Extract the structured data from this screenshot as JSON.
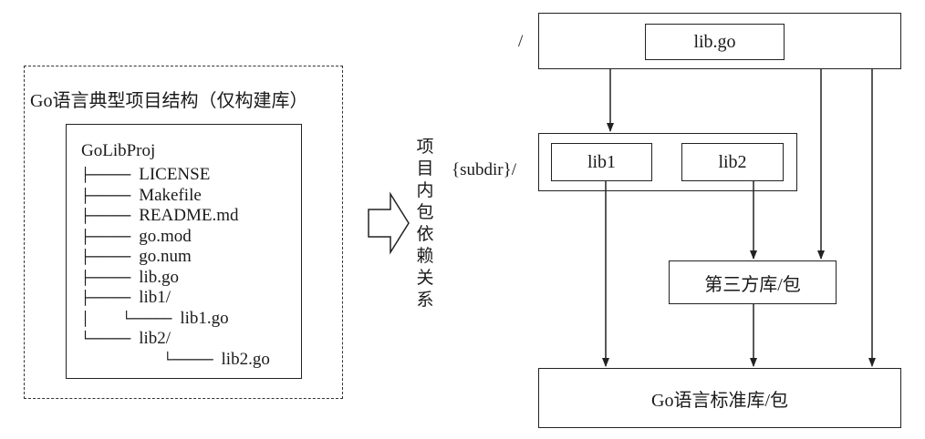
{
  "left_panel": {
    "title": "Go语言典型项目结构（仅构建库）",
    "root": "GoLibProj",
    "tree": [
      {
        "prefix": "├───── ",
        "name": "LICENSE"
      },
      {
        "prefix": "├───── ",
        "name": "Makefile"
      },
      {
        "prefix": "├───── ",
        "name": "README.md"
      },
      {
        "prefix": "├───── ",
        "name": "go.mod"
      },
      {
        "prefix": "├───── ",
        "name": "go.num"
      },
      {
        "prefix": "├───── ",
        "name": "lib.go"
      },
      {
        "prefix": "├───── ",
        "name": "lib1/"
      },
      {
        "prefix": "│    └───── ",
        "name": "lib1.go"
      },
      {
        "prefix": "└───── ",
        "name": "lib2/"
      },
      {
        "prefix": "          └───── ",
        "name": "lib2.go"
      }
    ]
  },
  "arrow_label": "项目内包依赖关系",
  "right_panel": {
    "root_label": "/",
    "root_file": "lib.go",
    "subdir_label": "{subdir}/",
    "lib1": "lib1",
    "lib2": "lib2",
    "third_party": "第三方库/包",
    "stdlib": "Go语言标准库/包"
  }
}
